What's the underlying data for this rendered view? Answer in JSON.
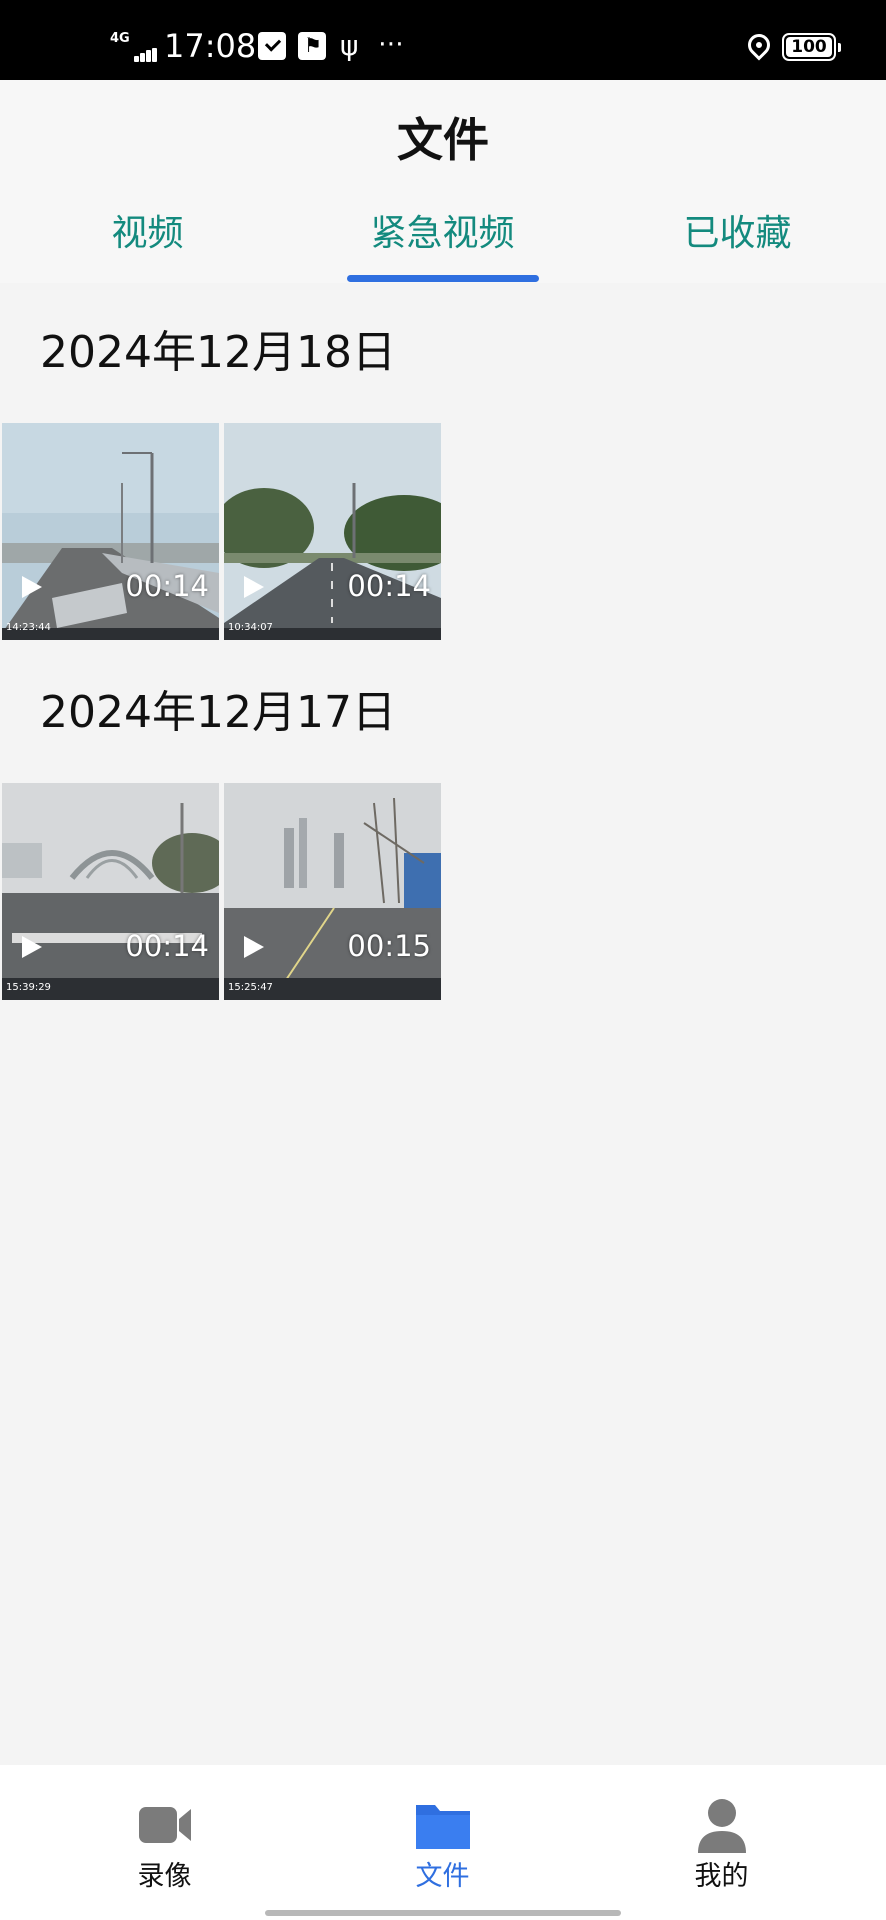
{
  "status_bar": {
    "network": "4G",
    "time": "17:08",
    "battery": "100"
  },
  "header": {
    "title": "文件",
    "tabs": [
      {
        "label": "视频",
        "active": false
      },
      {
        "label": "紧急视频",
        "active": true
      },
      {
        "label": "已收藏",
        "active": false
      }
    ]
  },
  "groups": [
    {
      "date": "2024年12月18日",
      "videos": [
        {
          "duration": "00:14",
          "timestamp": "14:23:44"
        },
        {
          "duration": "00:14",
          "timestamp": "10:34:07"
        }
      ]
    },
    {
      "date": "2024年12月17日",
      "videos": [
        {
          "duration": "00:14",
          "timestamp": "15:39:29"
        },
        {
          "duration": "00:15",
          "timestamp": "15:25:47"
        }
      ]
    }
  ],
  "bottom_nav": [
    {
      "label": "录像",
      "icon": "video-camera-icon",
      "active": false
    },
    {
      "label": "文件",
      "icon": "folder-icon",
      "active": true
    },
    {
      "label": "我的",
      "icon": "user-icon",
      "active": false
    }
  ],
  "colors": {
    "accent": "#2f6fe0",
    "tab_text": "#138a7e",
    "background": "#f4f4f4"
  }
}
